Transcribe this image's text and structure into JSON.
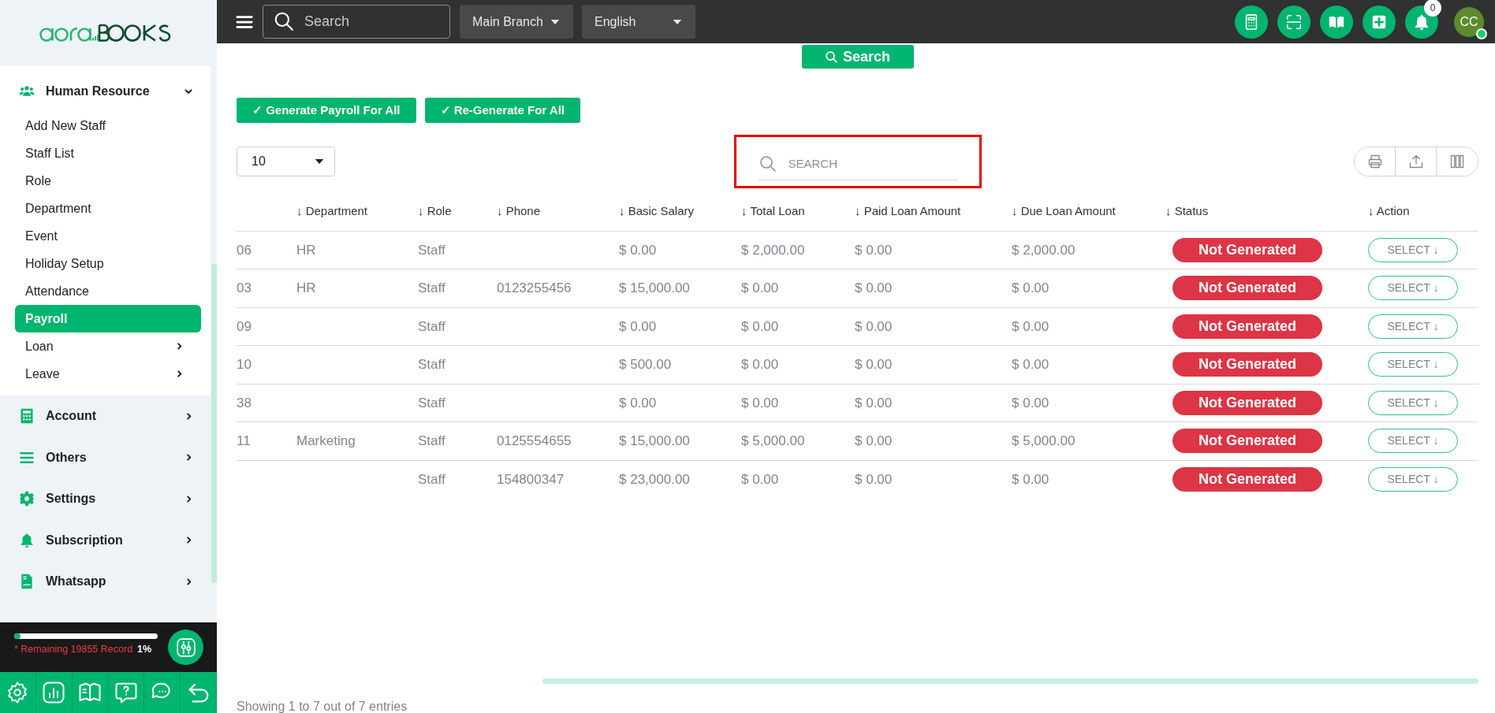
{
  "topbar": {
    "search": {
      "placeholder": "Search"
    },
    "branch": "Main Branch",
    "language": "English",
    "notification_count": "0",
    "avatar": "CC",
    "avatar_online": true
  },
  "sidebar": {
    "section": {
      "label": "Human Resource",
      "expanded": true,
      "items": [
        {
          "label": "Add New Staff",
          "selected": false,
          "has_submenu": false
        },
        {
          "label": "Staff List",
          "selected": false,
          "has_submenu": false
        },
        {
          "label": "Role",
          "selected": false,
          "has_submenu": false
        },
        {
          "label": "Department",
          "selected": false,
          "has_submenu": false
        },
        {
          "label": "Event",
          "selected": false,
          "has_submenu": false
        },
        {
          "label": "Holiday Setup",
          "selected": false,
          "has_submenu": false
        },
        {
          "label": "Attendance",
          "selected": false,
          "has_submenu": false
        },
        {
          "label": "Payroll",
          "selected": true,
          "has_submenu": false
        },
        {
          "label": "Loan",
          "selected": false,
          "has_submenu": true
        },
        {
          "label": "Leave",
          "selected": false,
          "has_submenu": true
        }
      ]
    },
    "groups": [
      {
        "label": "Account",
        "expanded": false
      },
      {
        "label": "Others",
        "expanded": false
      },
      {
        "label": "Settings",
        "expanded": false
      },
      {
        "label": "Subscription",
        "expanded": false
      },
      {
        "label": "Whatsapp",
        "expanded": false
      }
    ],
    "usage": {
      "level": 0.02,
      "text": "* Remaining 19855 Record",
      "percent": "1%"
    }
  },
  "main": {
    "search_button": "Search",
    "actions": [
      "✓ Generate Payroll For All",
      "✓ Re-Generate For All"
    ],
    "page_length": "10",
    "table_search": {
      "placeholder": "SEARCH",
      "highlighted": true
    },
    "table": {
      "columns": [
        "",
        "↓ Department",
        "↓ Role",
        "↓ Phone",
        "↓ Basic Salary",
        "↓ Total Loan",
        "↓ Paid Loan Amount",
        "↓ Due Loan Amount",
        "↓ Status",
        "↓ Action"
      ],
      "rows": [
        {
          "cells": [
            "06",
            "HR",
            "Staff",
            "",
            "$ 0.00",
            "$ 2,000.00",
            "$ 0.00",
            "$ 2,000.00"
          ],
          "status": "Not Generated",
          "action": "SELECT ↓"
        },
        {
          "cells": [
            "03",
            "HR",
            "Staff",
            "0123255456",
            "$ 15,000.00",
            "$ 0.00",
            "$ 0.00",
            "$ 0.00"
          ],
          "status": "Not Generated",
          "action": "SELECT ↓"
        },
        {
          "cells": [
            "09",
            "",
            "Staff",
            "",
            "$ 0.00",
            "$ 0.00",
            "$ 0.00",
            "$ 0.00"
          ],
          "status": "Not Generated",
          "action": "SELECT ↓"
        },
        {
          "cells": [
            "10",
            "",
            "Staff",
            "",
            "$ 500.00",
            "$ 0.00",
            "$ 0.00",
            "$ 0.00"
          ],
          "status": "Not Generated",
          "action": "SELECT ↓"
        },
        {
          "cells": [
            "38",
            "",
            "Staff",
            "",
            "$ 0.00",
            "$ 0.00",
            "$ 0.00",
            "$ 0.00"
          ],
          "status": "Not Generated",
          "action": "SELECT ↓"
        },
        {
          "cells": [
            "11",
            "Marketing",
            "Staff",
            "0125554655",
            "$ 15,000.00",
            "$ 5,000.00",
            "$ 0.00",
            "$ 5,000.00"
          ],
          "status": "Not Generated",
          "action": "SELECT ↓"
        },
        {
          "cells": [
            "",
            "",
            "Staff",
            "154800347",
            "$ 23,000.00",
            "$ 0.00",
            "$ 0.00",
            "$ 0.00"
          ],
          "status": "Not Generated",
          "action": "SELECT ↓"
        }
      ]
    },
    "footer": "Showing 1 to 7 out of 7 entries"
  }
}
